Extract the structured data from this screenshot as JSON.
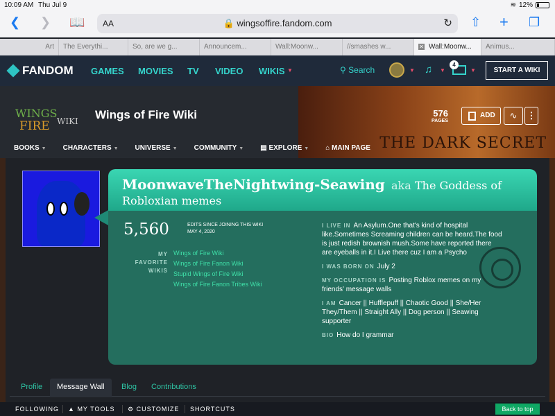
{
  "status": {
    "time": "10:09 AM",
    "date": "Thu Jul 9",
    "battery": "12%"
  },
  "browser": {
    "text_size_label": "AA",
    "url": "wingsoffire.fandom.com",
    "tabs": [
      "Art",
      "The Everythi...",
      "So, are we g...",
      "Announcem...",
      "Wall:Moonw...",
      "//smashes w...",
      "Wall:Moonw...",
      "Animus..."
    ],
    "active_tab_index": 6
  },
  "fandom": {
    "brand": "FANDOM",
    "nav": [
      "GAMES",
      "MOVIES",
      "TV",
      "VIDEO",
      "WIKIS"
    ],
    "search_label": "Search",
    "notification_count": "4",
    "start_wiki": "START A WIKI"
  },
  "wiki": {
    "logo_line1": "WINGS",
    "logo_line2": "FIRE",
    "logo_word": "WIKI",
    "title": "Wings of Fire Wiki",
    "pages_count": "576",
    "pages_label": "PAGES",
    "add_label": "ADD",
    "nav": [
      "BOOKS",
      "CHARACTERS",
      "UNIVERSE",
      "COMMUNITY",
      "EXPLORE",
      "MAIN PAGE"
    ],
    "banner_text": "THE DARK SECRET"
  },
  "profile": {
    "username": "MoonwaveTheNightwing-Seawing",
    "aka_label": "aka",
    "aka_line1": "The Goddess of",
    "aka_line2": "Robloxian memes",
    "edits": "5,560",
    "edits_label": "EDITS SINCE JOINING THIS WIKI",
    "edits_date": "MAY 4, 2020",
    "favorite_label": "MY FAVORITE WIKIS",
    "favorite_wikis": [
      "Wings of Fire Wiki",
      "Wings of Fire Fanon Wiki",
      "Stupid Wings of Fire Wiki",
      "Wings of Fire Fanon Tribes Wiki"
    ],
    "info": [
      {
        "label": "I LIVE IN",
        "value": "An Asylum.One that's kind of hospital like.Sometimes Screaming children can be heard.The food is just redish brownish mush.Some have reported there are eyeballs in it.I Live there cuz I am a Psycho"
      },
      {
        "label": "I WAS BORN ON",
        "value": "July 2"
      },
      {
        "label": "MY OCCUPATION IS",
        "value": "Posting Roblox memes on my friends' message walls"
      },
      {
        "label": "I AM",
        "value": "Cancer || Hufflepuff || Chaotic Good || She/Her They/Them || Straight Ally || Dog person || Seawing supporter"
      },
      {
        "label": "BIO",
        "value": "How do I grammar"
      }
    ],
    "tabs": [
      "Profile",
      "Message Wall",
      "Blog",
      "Contributions"
    ]
  },
  "toolbar": {
    "following": "FOLLOWING",
    "my_tools": "MY TOOLS",
    "customize": "CUSTOMIZE",
    "shortcuts": "SHORTCUTS",
    "back_to_top": "Back to top"
  },
  "colors": {
    "accent": "#35d4cc",
    "card": "#246e5e",
    "card_header": "#2ac4a2",
    "nav_bg": "#1f2a3a"
  }
}
